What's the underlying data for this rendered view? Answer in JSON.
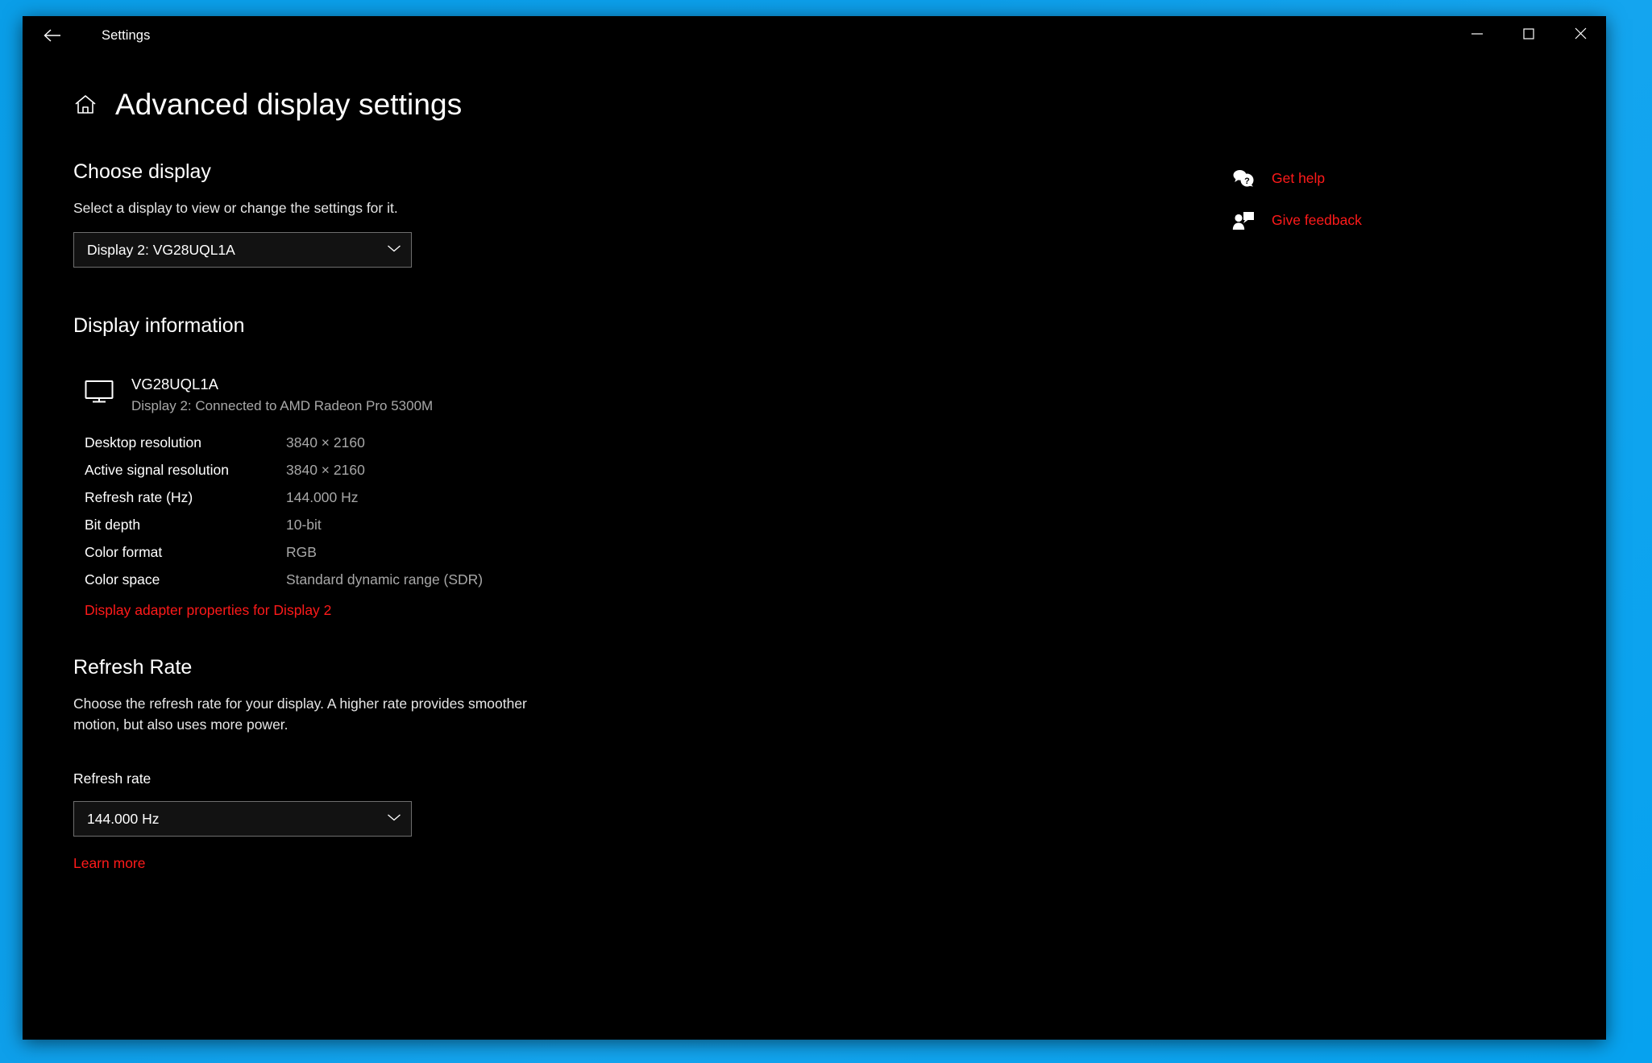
{
  "titlebar": {
    "app_title": "Settings",
    "back_icon": "back-arrow-icon",
    "minimize_icon": "minimize-icon",
    "maximize_icon": "maximize-icon",
    "close_icon": "close-icon"
  },
  "header": {
    "home_icon": "home-icon",
    "title": "Advanced display settings"
  },
  "help": {
    "items": [
      {
        "label": "Get help",
        "icon": "question-bubble-icon"
      },
      {
        "label": "Give feedback",
        "icon": "feedback-person-icon"
      }
    ],
    "link_color": "#ff1a1a"
  },
  "choose_display": {
    "heading": "Choose display",
    "description": "Select a display to view or change the settings for it.",
    "selected": "Display 2: VG28UQL1A",
    "chevron_icon": "chevron-down-icon"
  },
  "display_information": {
    "heading": "Display information",
    "device_icon": "monitor-icon",
    "device_name": "VG28UQL1A",
    "device_connection": "Display 2: Connected to AMD Radeon Pro 5300M",
    "specs": [
      {
        "label": "Desktop resolution",
        "value": "3840 × 2160"
      },
      {
        "label": "Active signal resolution",
        "value": "3840 × 2160"
      },
      {
        "label": "Refresh rate (Hz)",
        "value": "144.000 Hz"
      },
      {
        "label": "Bit depth",
        "value": "10-bit"
      },
      {
        "label": "Color format",
        "value": "RGB"
      },
      {
        "label": "Color space",
        "value": "Standard dynamic range (SDR)"
      }
    ],
    "adapter_link": "Display adapter properties for Display 2"
  },
  "refresh_rate": {
    "heading": "Refresh Rate",
    "description": "Choose the refresh rate for your display. A higher rate provides smoother motion, but also uses more power.",
    "field_label": "Refresh rate",
    "selected": "144.000 Hz",
    "chevron_icon": "chevron-down-icon",
    "learn_more": "Learn more"
  },
  "theme": {
    "window_background": "#000000",
    "desktop_background": "#0d9ee9",
    "accent_link": "#ff1a1a",
    "secondary_text": "#a8a8a8",
    "border": "#6e6e6e"
  }
}
